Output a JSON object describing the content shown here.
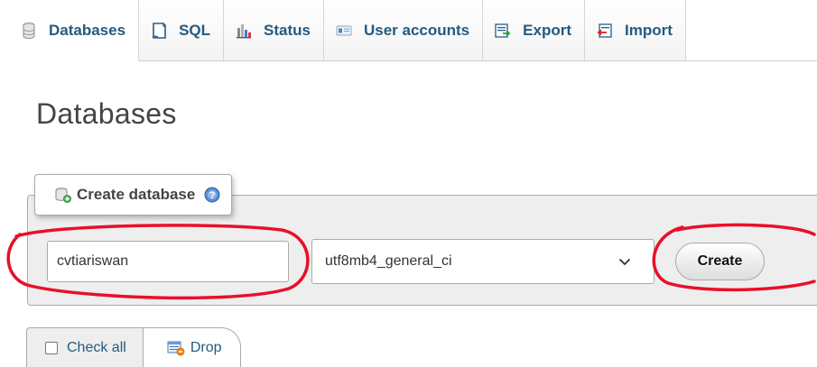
{
  "tabs": [
    {
      "label": "Databases",
      "icon": "database-icon",
      "active": true
    },
    {
      "label": "SQL",
      "icon": "sql-icon",
      "active": false
    },
    {
      "label": "Status",
      "icon": "status-chart-icon",
      "active": false
    },
    {
      "label": "User accounts",
      "icon": "user-accounts-icon",
      "active": false
    },
    {
      "label": "Export",
      "icon": "export-icon",
      "active": false
    },
    {
      "label": "Import",
      "icon": "import-icon",
      "active": false
    }
  ],
  "page": {
    "title": "Databases"
  },
  "create_database": {
    "legend": "Create database",
    "name_value": "cvtiariswan",
    "collation_selected": "utf8mb4_general_ci",
    "create_label": "Create"
  },
  "bulk_actions": {
    "check_all_label": "Check all",
    "drop_label": "Drop"
  },
  "colors": {
    "link_blue": "#235a81",
    "annotation_red": "#e8102a",
    "fieldset_bg": "#eeeeee"
  }
}
